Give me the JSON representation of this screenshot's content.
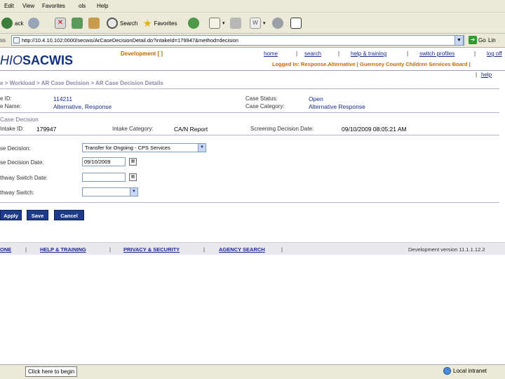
{
  "menu": [
    "Edit",
    "View",
    "Favorites",
    "ols",
    "Help"
  ],
  "toolbar": {
    "search_label": "Search",
    "favorites_label": "Favorites"
  },
  "address": {
    "label": "ss",
    "url": "http://10.4.10.102:0000/secwis/ArCaseDecisionDetail.do?intakeId=179947&method=decision",
    "go_label": "Go",
    "links_label": "Lin"
  },
  "header": {
    "logo_prefix": "HIO",
    "logo_main": "SACWIS",
    "dev_label": "Development [ ]",
    "links": [
      "home",
      "search",
      "help & training",
      "switch profiles",
      "log off"
    ],
    "logged_in": "Logged In: Response.Alternative | Guernsey County Children Services Board |",
    "help": "help"
  },
  "breadcrumb": "e > Workload > AR Case Decision > AR Case Decision Details",
  "case": {
    "id_label": "e ID:",
    "id_value": "114211",
    "name_label": "e Name:",
    "name_value": "Alternative, Response",
    "status_label": "Case Status:",
    "status_value": "Open",
    "category_label": "Case Category:",
    "category_value": "Alternative Response"
  },
  "section_title": "Case Decision",
  "intake": {
    "id_label": "Intake ID:",
    "id_value": "179947",
    "category_label": "Intake Category:",
    "category_value": "CA/N Report",
    "screening_label": "Screening Decision Date:",
    "screening_value": "09/10/2009 08:05:21 AM"
  },
  "form": {
    "decision_label": "se Decision:",
    "decision_value": "Transfer for Ongoing - CPS Services",
    "decision_date_label": "se Decision Date:",
    "decision_date_value": "09/10/2009",
    "switch_date_label": "thway Switch Date:",
    "switch_date_value": "",
    "switch_label": "thway Switch:",
    "switch_value": ""
  },
  "buttons": {
    "apply": "Apply",
    "save": "Save",
    "cancel": "Cancel"
  },
  "footer": {
    "links": [
      "ONE",
      "HELP & TRAINING",
      "PRIVACY & SECURITY",
      "AGENCY SEARCH"
    ],
    "version": "Development version 11.1.1.12.2"
  },
  "status": {
    "left": "Click here to begin",
    "right": "Local intranet"
  },
  "colors": {
    "brand_navy": "#13317e",
    "link_blue": "#1a2a8f",
    "accent_orange": "#c66a00",
    "button_navy": "#1e3a8a"
  }
}
